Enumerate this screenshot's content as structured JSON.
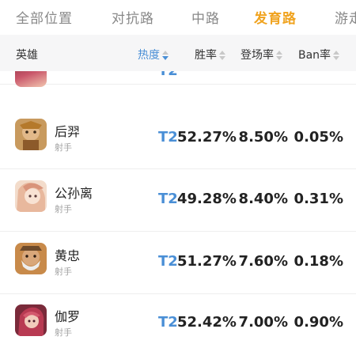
{
  "tabs": [
    {
      "label": "全部位置",
      "active": false
    },
    {
      "label": "对抗路",
      "active": false
    },
    {
      "label": "中路",
      "active": false
    },
    {
      "label": "发育路",
      "active": true
    },
    {
      "label": "游走",
      "active": false
    }
  ],
  "columns": {
    "hero": "英雄",
    "heat": "热度",
    "win_rate": "胜率",
    "pick_rate": "登场率",
    "ban_rate": "Ban率"
  },
  "partial_row": {
    "tier": "T2"
  },
  "heroes": [
    {
      "name": "后羿",
      "role": "射手",
      "tier": "T2",
      "win_rate": "52.27%",
      "pick_rate": "8.50%",
      "ban_rate": "0.05%",
      "avatar_icon": "houyi-avatar-icon"
    },
    {
      "name": "公孙离",
      "role": "射手",
      "tier": "T2",
      "win_rate": "49.28%",
      "pick_rate": "8.40%",
      "ban_rate": "0.31%",
      "avatar_icon": "gongsunli-avatar-icon"
    },
    {
      "name": "黄忠",
      "role": "射手",
      "tier": "T2",
      "win_rate": "51.27%",
      "pick_rate": "7.60%",
      "ban_rate": "0.18%",
      "avatar_icon": "huangzhong-avatar-icon"
    },
    {
      "name": "伽罗",
      "role": "射手",
      "tier": "T2",
      "win_rate": "52.42%",
      "pick_rate": "7.00%",
      "ban_rate": "0.90%",
      "avatar_icon": "jialuo-avatar-icon"
    }
  ],
  "colors": {
    "active_tab": "#f0a31f",
    "tier": "#4a8fd6",
    "sort_active": "#4a8fd6"
  }
}
